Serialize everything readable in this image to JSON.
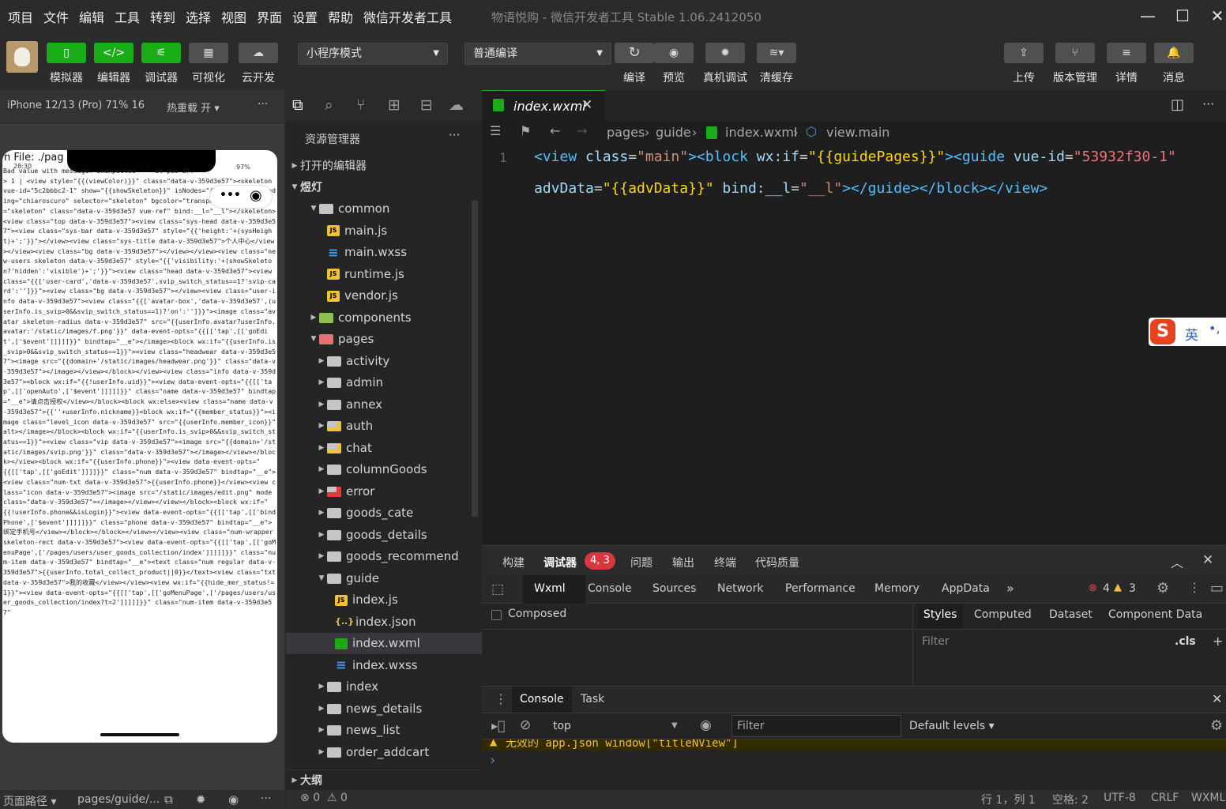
{
  "menu": {
    "items": [
      "项目",
      "文件",
      "编辑",
      "工具",
      "转到",
      "选择",
      "视图",
      "界面",
      "设置",
      "帮助",
      "微信开发者工具"
    ],
    "window_title": "物语悦购 - 微信开发者工具 Stable 1.06.2412050"
  },
  "toolbar": {
    "simulator": "模拟器",
    "editor": "编辑器",
    "debugger": "调试器",
    "visual": "可视化",
    "cloud": "云开发",
    "mode_select": "小程序模式",
    "compile_select": "普通编译",
    "compile": "编译",
    "preview": "预览",
    "real_debug": "真机调试",
    "clear_cache": "清缓存",
    "upload": "上传",
    "version": "版本管理",
    "details": "详情",
    "messages": "消息"
  },
  "simulator": {
    "device": "iPhone 12/13 (Pro) 71% 16",
    "hot_reload": "热重载 开",
    "more": "···",
    "file_label": "n File: ./pag",
    "time": "28:30",
    "battery": "97%",
    "code_dump": "Bad value with message: unexpected `~` at pos 27.\n> 1 | <view style=\"{{(viewColor)}}\" class=\"data-v-359d3e57\"><skeleton vue-id=\"5c2bbbc2-1\" show=\"{{showSkeleton}}\" isNodes=\"{{isNodes}}\" loading=\"chiaroscuro\" selector=\"skeleton\" bgcolor=\"transparent\" data-ref=\"skeleton\" class=\"data-v-359d3e57 vue-ref\" bind:__l=\"__l\"></skeleton><view class=\"top data-v-359d3e57\"><view class=\"sys-head data-v-359d3e57\"><view class=\"sys-bar data-v-359d3e57\" style=\"{{'height:'+(sysHeight)+';'}}\"></view><view class=\"sys-title data-v-359d3e57\">个人中心</view></view><view class=\"bg data-v-359d3e57\"></view></view><view class=\"new-users skeleton data-v-359d3e57\" style=\"{{'visibility:'+(showSkeleton?'hidden':'visible')+';'}}\"><view class=\"head data-v-359d3e57\"><view class=\"{{['user-card','data-v-359d3e57',svip_switch_status==1?'svip-card':'']}}\"><view class=\"bg data-v-359d3e57\"></view><view class=\"user-info data-v-359d3e57\"><view class=\"{{['avatar-box','data-v-359d3e57',(userInfo.is_svip>0&&svip_switch_status==1)?'on':'']}}\"><image class=\"avatar skeleton-radius data-v-359d3e57\" src=\"{{userInfo.avatar?userInfo.avatar:'/static/images/f.png'}}\" data-event-opts=\"{{[['tap',[['goEdit',['$event']]]]]}}\" bindtap=\"__e\"></image><block wx:if=\"{{userInfo.is_svip>0&&svip_switch_status==1}}\"><view class=\"headwear data-v-359d3e57\"><image src=\"{{domain+'/static/images/headwear.png'}}\" class=\"data-v-359d3e57\"></image></view></block></view><view class=\"info data-v-359d3e57\"><block wx:if=\"{{!userInfo.uid}}\"><view data-event-opts=\"{{[['tap',[['openAuto',['$event']]]]]}}\" class=\"name data-v-359d3e57\" bindtap=\"__e\">请点击授权</view></block><block wx:else><view class=\"name data-v-359d3e57\">{{''+userInfo.nickname}}<block wx:if=\"{{member_status}}\"><image class=\"level_icon data-v-359d3e57\" src=\"{{userInfo.member_icon}}\" alt></image></block><block wx:if=\"{{userInfo.is_svip>0&&svip_switch_status==1}}\"><view class=\"vip data-v-359d3e57\"><image src=\"{{domain+'/static/images/svip.png'}}\" class=\"data-v-359d3e57\"></image></view></block></view><block wx:if=\"{{userInfo.phone}}\"><view data-event-opts=\"{{[['tap',[['goEdit']]]]}}\" class=\"num data-v-359d3e57\" bindtap=\"__e\"><view class=\"num-txt data-v-359d3e57\">{{userInfo.phone}}</view><view class=\"icon data-v-359d3e57\"><image src=\"/static/images/edit.png\" mode class=\"data-v-359d3e57\"></image></view></view></block><block wx:if=\"{{!userInfo.phone&&isLogin}}\"><view data-event-opts=\"{{[['tap',[['bindPhone',['$event']]]]]}}\" class=\"phone data-v-359d3e57\" bindtap=\"__e\">绑定手机号</view></block></block></view></view><view class=\"num-wrapper skeleton-rect data-v-359d3e57\"><view data-event-opts=\"{{[['tap',[['goMenuPage',['/pages/users/user_goods_collection/index']]]]]}}\" class=\"num-item data-v-359d3e57\" bindtap=\"__e\"><text class=\"num regular data-v-359d3e57\">{{userInfo.total_collect_product||0}}</text><view class=\"txt data-v-359d3e57\">我的收藏</view></view><view wx:if=\"{{hide_mer_status!=1}}\"><view data-event-opts=\"{{[['tap',[['goMenuPage',['/pages/users/user_goods_collection/index?t=2']]]]]}}\" class=\"num-item data-v-359d3e57\""
  },
  "sim_footer": {
    "path_label": "页面路径",
    "path_value": "pages/guide/..."
  },
  "explorer": {
    "title": "资源管理器",
    "open_editors": "打开的编辑器",
    "project": "煜灯",
    "outline": "大纲",
    "rows": [
      {
        "label": "common",
        "depth": 1,
        "type": "folder-open"
      },
      {
        "label": "main.js",
        "depth": 2,
        "type": "js"
      },
      {
        "label": "main.wxss",
        "depth": 2,
        "type": "css"
      },
      {
        "label": "runtime.js",
        "depth": 2,
        "type": "js"
      },
      {
        "label": "vendor.js",
        "depth": 2,
        "type": "js"
      },
      {
        "label": "components",
        "depth": 1,
        "type": "folder-green"
      },
      {
        "label": "pages",
        "depth": 1,
        "type": "folder-red-open"
      },
      {
        "label": "activity",
        "depth": 2,
        "type": "folder"
      },
      {
        "label": "admin",
        "depth": 2,
        "type": "folder"
      },
      {
        "label": "annex",
        "depth": 2,
        "type": "folder"
      },
      {
        "label": "auth",
        "depth": 2,
        "type": "folder-lock"
      },
      {
        "label": "chat",
        "depth": 2,
        "type": "folder-chat"
      },
      {
        "label": "columnGoods",
        "depth": 2,
        "type": "folder"
      },
      {
        "label": "error",
        "depth": 2,
        "type": "folder-error"
      },
      {
        "label": "goods_cate",
        "depth": 2,
        "type": "folder"
      },
      {
        "label": "goods_details",
        "depth": 2,
        "type": "folder"
      },
      {
        "label": "goods_recommend",
        "depth": 2,
        "type": "folder"
      },
      {
        "label": "guide",
        "depth": 2,
        "type": "folder-open"
      },
      {
        "label": "index.js",
        "depth": 3,
        "type": "js"
      },
      {
        "label": "index.json",
        "depth": 3,
        "type": "json"
      },
      {
        "label": "index.wxml",
        "depth": 3,
        "type": "wxml"
      },
      {
        "label": "index.wxss",
        "depth": 3,
        "type": "css"
      },
      {
        "label": "index",
        "depth": 2,
        "type": "folder"
      },
      {
        "label": "news_details",
        "depth": 2,
        "type": "folder"
      },
      {
        "label": "news_list",
        "depth": 2,
        "type": "folder"
      },
      {
        "label": "order_addcart",
        "depth": 2,
        "type": "folder"
      }
    ]
  },
  "editor": {
    "tab_name": "index.wxml",
    "breadcrumb": [
      "pages",
      "guide",
      "index.wxml",
      "view.main"
    ],
    "line_number": "1",
    "code": {
      "l1_a": "<view ",
      "l1_b": "class",
      "l1_c": "=",
      "l1_d": "\"main\"",
      "l1_e": "><block ",
      "l1_f": "wx:if",
      "l1_g": "=",
      "l1_h": "\"{{guidePages}}\"",
      "l1_i": "><guide ",
      "l1_j": "vue-id",
      "l1_k": "=",
      "l1_l": "\"53932f30-1\"",
      "l2_a": "advData",
      "l2_b": "=",
      "l2_c": "\"{{advData}}\"",
      "l2_d": " bind:__l",
      "l2_e": "=",
      "l2_f": "\"__l\"",
      "l2_g": "></guide></block></view>"
    }
  },
  "ime": {
    "label": "英"
  },
  "devtools": {
    "top_tabs": [
      "构建",
      "调试器",
      "问题",
      "输出",
      "终端",
      "代码质量"
    ],
    "badge": "4, 3",
    "panel_tabs": [
      "Wxml",
      "Console",
      "Sources",
      "Network",
      "Performance",
      "Memory",
      "AppData"
    ],
    "errors": "4",
    "warnings": "3",
    "composed": "Composed",
    "style_tabs": [
      "Styles",
      "Computed",
      "Dataset",
      "Component Data"
    ],
    "filter_placeholder": "Filter",
    "cls": ".cls",
    "drawer_tabs": [
      "Console",
      "Task"
    ],
    "context": "top",
    "console_filter": "Filter",
    "levels": "Default levels",
    "warning_msg": "无效的 app.json window[\"titleNView\"]",
    "prompt": "›"
  },
  "status": {
    "errors": "0",
    "warnings": "0",
    "position": "行 1，列 1",
    "spaces": "空格: 2",
    "encoding": "UTF-8",
    "eol": "CRLF",
    "lang": "WXML"
  }
}
